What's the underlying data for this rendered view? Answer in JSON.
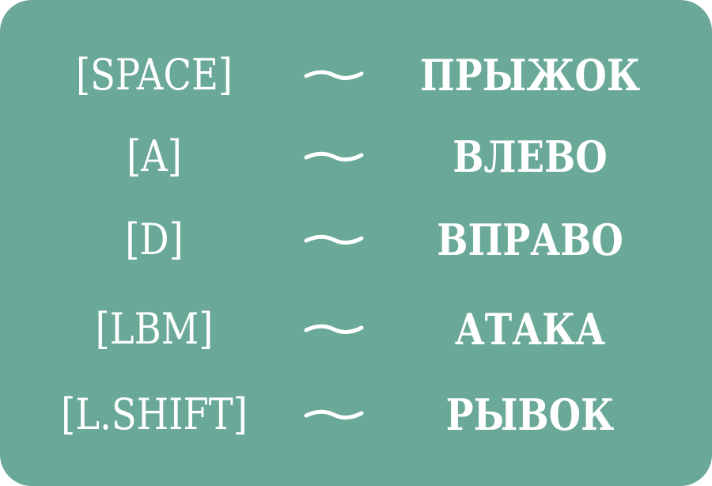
{
  "controls": [
    {
      "key": "[SPACE]",
      "separator": "—",
      "action": "ПРЫЖОК"
    },
    {
      "key": "[A]",
      "separator": "—",
      "action": "ВЛЕВО"
    },
    {
      "key": "[D]",
      "separator": "—",
      "action": "ВПРАВО"
    },
    {
      "key": "[LBM]",
      "separator": "—",
      "action": "АТАКА"
    },
    {
      "key": "[L.SHIFT]",
      "separator": "—",
      "action": "РЫВОК"
    }
  ],
  "colors": {
    "panel_background": "#6aa898",
    "text": "#ffffff"
  },
  "icons": {
    "separator": "wavy-dash-icon"
  }
}
